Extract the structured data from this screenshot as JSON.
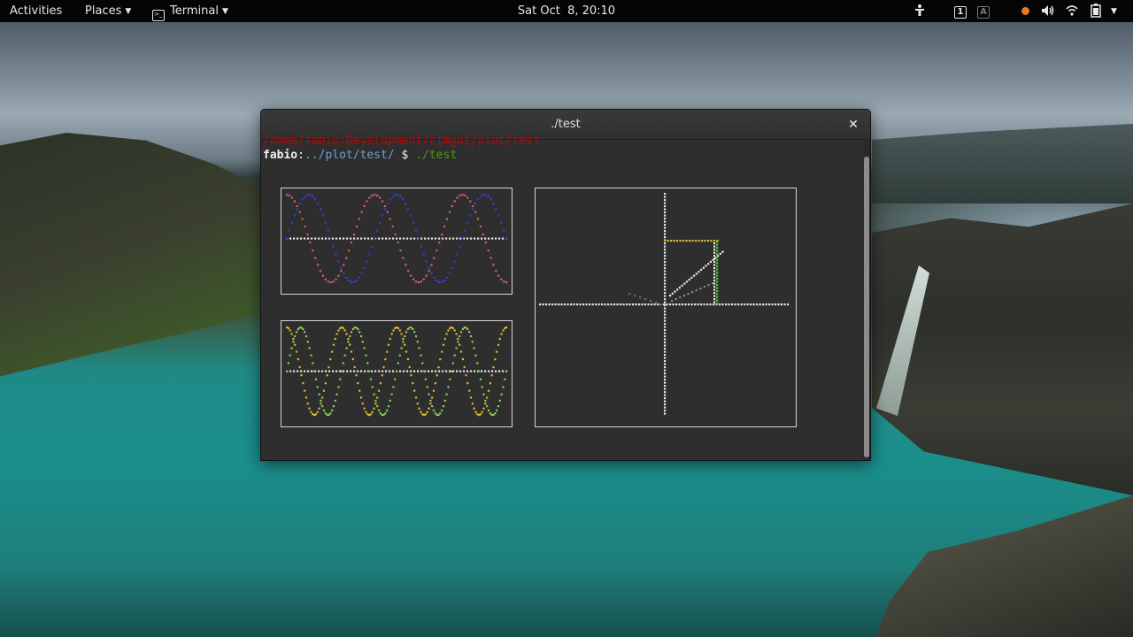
{
  "topbar": {
    "activities": "Activities",
    "places": "Places",
    "app_name": "Terminal",
    "clock": "Sat Oct  8, 20:10",
    "workspace_1": "1",
    "workspace_2": "A"
  },
  "window": {
    "title": "./test",
    "close_glyph": "✕"
  },
  "terminal": {
    "path_line": "/home/fabio/Development/cimgui/plot/test",
    "prompt_user": "fabio",
    "prompt_colon": ":",
    "prompt_dir": "../plot/test/",
    "prompt_symbol": "$",
    "command": "./test"
  },
  "colors": {
    "sine_blue": "#3c3cd2",
    "sine_red": "#d25f6e",
    "wave_green": "#8ccc54",
    "wave_yellow": "#d8b832",
    "axis": "#e8e8e8",
    "unit_top": "#d8c040",
    "unit_right": "#59c040"
  },
  "icons": {
    "app_icon": "terminal-icon",
    "tray": [
      "accessibility-icon",
      "workspace-icon",
      "keyboard-icon",
      "notification-dot-icon",
      "volume-icon",
      "wifi-icon",
      "battery-icon",
      "power-menu-icon"
    ]
  },
  "chart_data": [
    {
      "type": "line",
      "series": [
        {
          "color": "#3c3cd2",
          "values_desc": "sine",
          "amplitude": 1,
          "cycles": 2.5,
          "phase": 0
        },
        {
          "color": "#d25f6e",
          "values_desc": "cosine",
          "amplitude": 1,
          "cycles": 2.5,
          "phase": 1.57
        }
      ],
      "baseline": "dotted",
      "ylim": [
        -1,
        1
      ]
    },
    {
      "type": "line",
      "series": [
        {
          "color": "#8ccc54",
          "amplitude": 1,
          "cycles": 4,
          "phase": 0
        },
        {
          "color": "#d8b832",
          "amplitude": 1,
          "cycles": 4,
          "phase": 1.57
        }
      ],
      "baseline": "dotted",
      "ylim": [
        -1,
        1
      ]
    },
    {
      "type": "scatter",
      "description_axes": "cartesian axes with unit-circle construction",
      "angle_deg": 45,
      "xlim": [
        -1,
        1.2
      ],
      "ylim": [
        -1,
        1.2
      ]
    }
  ]
}
